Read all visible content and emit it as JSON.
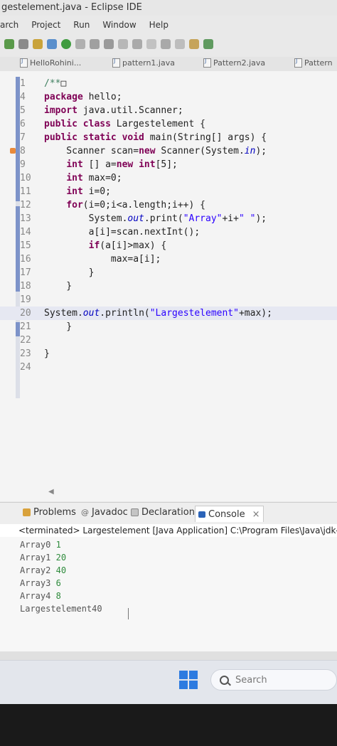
{
  "window": {
    "title": "gestelement.java - Eclipse IDE"
  },
  "menu": [
    "arch",
    "Project",
    "Run",
    "Window",
    "Help"
  ],
  "editor_tabs": [
    "HelloRohini...",
    "pattern1.java",
    "Pattern2.java",
    "Pattern"
  ],
  "code_lines": [
    {
      "num": "1",
      "parts": [
        {
          "t": "/**",
          "c": "cmt"
        },
        {
          "t": "□",
          "c": ""
        }
      ]
    },
    {
      "num": "4",
      "parts": [
        {
          "t": "package",
          "c": "kw"
        },
        {
          "t": " hello;",
          "c": ""
        }
      ]
    },
    {
      "num": "5",
      "parts": [
        {
          "t": "import",
          "c": "kw"
        },
        {
          "t": " java.util.Scanner;",
          "c": ""
        }
      ]
    },
    {
      "num": "6",
      "parts": [
        {
          "t": "public class",
          "c": "kw"
        },
        {
          "t": " Largestelement {",
          "c": ""
        }
      ]
    },
    {
      "num": "7",
      "parts": [
        {
          "t": "public static void",
          "c": "kw"
        },
        {
          "t": " main(String[] args) {",
          "c": ""
        }
      ]
    },
    {
      "num": "8",
      "parts": [
        {
          "t": "    Scanner scan=",
          "c": ""
        },
        {
          "t": "new",
          "c": "kw"
        },
        {
          "t": " Scanner(System.",
          "c": ""
        },
        {
          "t": "in",
          "c": "fld"
        },
        {
          "t": ");",
          "c": ""
        }
      ]
    },
    {
      "num": "9",
      "parts": [
        {
          "t": "    ",
          "c": ""
        },
        {
          "t": "int",
          "c": "kw"
        },
        {
          "t": " [] a=",
          "c": ""
        },
        {
          "t": "new int",
          "c": "kw"
        },
        {
          "t": "[5];",
          "c": ""
        }
      ]
    },
    {
      "num": "10",
      "parts": [
        {
          "t": "    ",
          "c": ""
        },
        {
          "t": "int",
          "c": "kw"
        },
        {
          "t": " max=0;",
          "c": ""
        }
      ]
    },
    {
      "num": "11",
      "parts": [
        {
          "t": "    ",
          "c": ""
        },
        {
          "t": "int",
          "c": "kw"
        },
        {
          "t": " i=0;",
          "c": ""
        }
      ]
    },
    {
      "num": "12",
      "parts": [
        {
          "t": "    ",
          "c": ""
        },
        {
          "t": "for",
          "c": "kw"
        },
        {
          "t": "(i=0;i<a.length;i++) {",
          "c": ""
        }
      ]
    },
    {
      "num": "13",
      "parts": [
        {
          "t": "        System.",
          "c": ""
        },
        {
          "t": "out",
          "c": "fld"
        },
        {
          "t": ".print(",
          "c": ""
        },
        {
          "t": "\"Array\"",
          "c": "str"
        },
        {
          "t": "+i+",
          "c": ""
        },
        {
          "t": "\" \"",
          "c": "str"
        },
        {
          "t": ");",
          "c": ""
        }
      ]
    },
    {
      "num": "14",
      "parts": [
        {
          "t": "        a[i]=scan.nextInt();",
          "c": ""
        }
      ]
    },
    {
      "num": "15",
      "parts": [
        {
          "t": "        ",
          "c": ""
        },
        {
          "t": "if",
          "c": "kw"
        },
        {
          "t": "(a[i]>max) {",
          "c": ""
        }
      ]
    },
    {
      "num": "16",
      "parts": [
        {
          "t": "            max=a[i];",
          "c": ""
        }
      ]
    },
    {
      "num": "17",
      "parts": [
        {
          "t": "        }",
          "c": ""
        }
      ]
    },
    {
      "num": "18",
      "parts": [
        {
          "t": "    }",
          "c": ""
        }
      ]
    },
    {
      "num": "19",
      "parts": [
        {
          "t": "",
          "c": ""
        }
      ]
    },
    {
      "num": "20",
      "parts": [
        {
          "t": "System.",
          "c": ""
        },
        {
          "t": "out",
          "c": "fld"
        },
        {
          "t": ".println(",
          "c": ""
        },
        {
          "t": "\"Largestelement\"",
          "c": "str"
        },
        {
          "t": "+max);",
          "c": ""
        }
      ]
    },
    {
      "num": "21",
      "parts": [
        {
          "t": "    }",
          "c": ""
        }
      ]
    },
    {
      "num": "22",
      "parts": [
        {
          "t": "",
          "c": ""
        }
      ]
    },
    {
      "num": "23",
      "parts": [
        {
          "t": "}",
          "c": ""
        }
      ]
    },
    {
      "num": "24",
      "parts": [
        {
          "t": "",
          "c": ""
        }
      ]
    }
  ],
  "panel": {
    "tabs": [
      "Problems",
      "Javadoc",
      "Declaration",
      "Console"
    ],
    "close_glyph": "×",
    "console_header": "<terminated> Largestelement [Java Application] C:\\Program Files\\Java\\jdk-",
    "output": [
      {
        "label": "Array0",
        "input": "1"
      },
      {
        "label": "Array1",
        "input": "20"
      },
      {
        "label": "Array2",
        "input": "40"
      },
      {
        "label": "Array3",
        "input": "6"
      },
      {
        "label": "Array4",
        "input": "8"
      },
      {
        "label": "Largestelement40",
        "input": ""
      }
    ]
  },
  "taskbar": {
    "search_placeholder": "Search"
  },
  "colors": {
    "keyword": "#7f0055",
    "field": "#0000c0",
    "string": "#2a00ff",
    "console_input": "#2e8b3c",
    "windows_blue": "#2d7be0"
  }
}
